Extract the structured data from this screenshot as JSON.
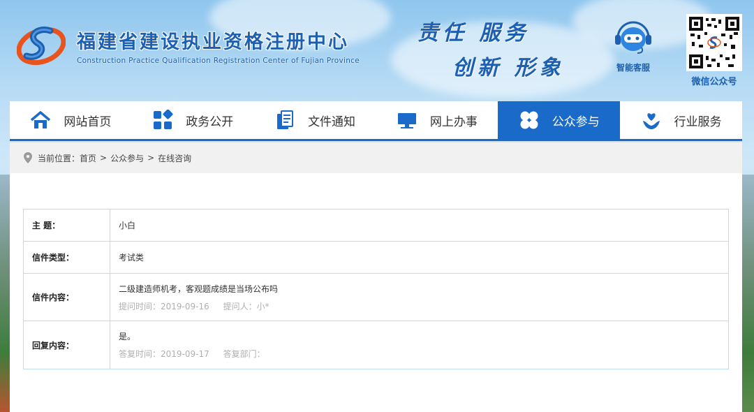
{
  "header": {
    "title_cn": "福建省建设执业资格注册中心",
    "title_en": "Construction Practice Qualification Registration Center of Fujian Province",
    "slogan_line1": "责任 服务",
    "slogan_line2": "创新 形象",
    "service_label": "智能客服",
    "qr_label": "微信公众号"
  },
  "nav": {
    "items": [
      {
        "label": "网站首页",
        "icon": "home-icon"
      },
      {
        "label": "政务公开",
        "icon": "grid-icon"
      },
      {
        "label": "文件通知",
        "icon": "document-icon"
      },
      {
        "label": "网上办事",
        "icon": "monitor-icon"
      },
      {
        "label": "公众参与",
        "icon": "clover-icon"
      },
      {
        "label": "行业服务",
        "icon": "heart-hand-icon"
      }
    ],
    "active_index": 4
  },
  "breadcrumb": {
    "prefix": "当前位置：",
    "items": [
      "首页",
      "公众参与",
      "在线咨询"
    ],
    "separator": ">"
  },
  "detail": {
    "subject_label": "主 题：",
    "subject_value": "小白",
    "type_label": "信件类型：",
    "type_value": "考试类",
    "content_label": "信件内容：",
    "content_value": "二级建造师机考，客观题成绩是当场公布吗",
    "ask_time": "提问时间：2019-09-16",
    "asker": "提问人：小*",
    "reply_label": "回复内容：",
    "reply_value": "是。",
    "reply_time": "答复时间：2019-09-17",
    "reply_dept": "答复部门："
  },
  "colors": {
    "brand_blue": "#1a6ac9",
    "title_blue": "#1d5fb0",
    "table_border": "#b9dcee",
    "meta_gray": "#b0b0b0"
  }
}
